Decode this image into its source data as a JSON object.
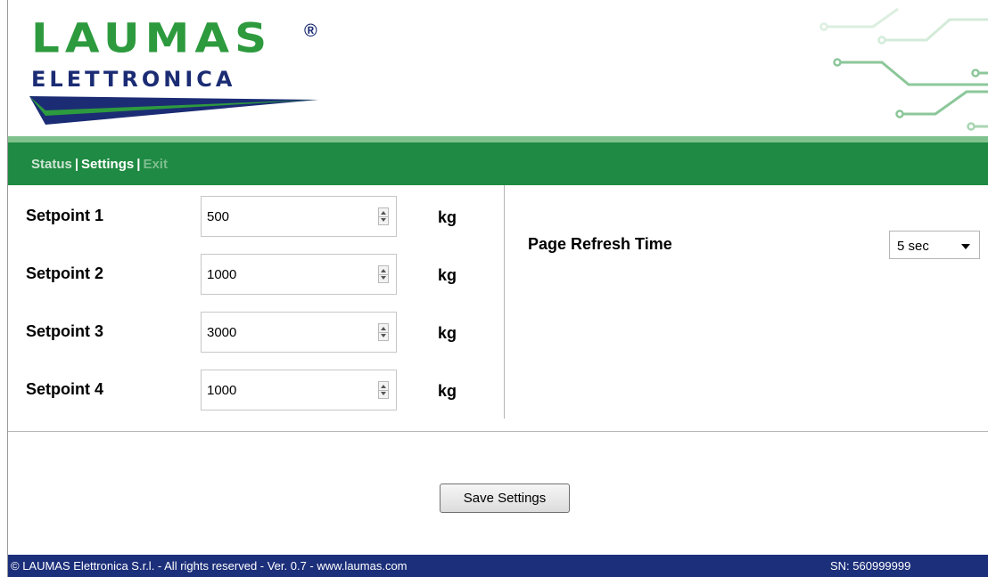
{
  "brand": {
    "name": "LAUMAS",
    "registered": "®",
    "subtitle": "ELETTRONICA"
  },
  "nav": {
    "items": [
      "Status",
      "Settings",
      "Exit"
    ],
    "separator": "|",
    "active": "Settings"
  },
  "setpoints": [
    {
      "label": "Setpoint 1",
      "value": "500",
      "unit": "kg"
    },
    {
      "label": "Setpoint 2",
      "value": "1000",
      "unit": "kg"
    },
    {
      "label": "Setpoint 3",
      "value": "3000",
      "unit": "kg"
    },
    {
      "label": "Setpoint 4",
      "value": "1000",
      "unit": "kg"
    }
  ],
  "refresh": {
    "label": "Page Refresh Time",
    "value": "5 sec"
  },
  "actions": {
    "save_label": "Save Settings"
  },
  "footer": {
    "copyright": "© LAUMAS Elettronica S.r.l. - All rights reserved - Ver. 0.7 - www.laumas.com",
    "serial": "SN: 560999999"
  },
  "colors": {
    "green": "#1f8a43",
    "light_green": "#7fc28d",
    "navy": "#1c2f7a",
    "logo_green": "#2d9a3e"
  },
  "icons": [
    "spinner-arrows-icon",
    "dropdown-caret-icon",
    "circuit-decoration"
  ]
}
